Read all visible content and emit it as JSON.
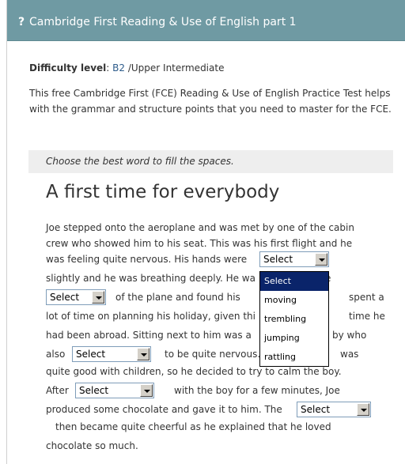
{
  "header": {
    "icon": "question-mark-icon",
    "title": "Cambridge First Reading & Use of English part 1",
    "bg_color": "#6f9aa3"
  },
  "difficulty": {
    "label": "Difficulty level",
    "level": "B2",
    "suffix": " /Upper Intermediate"
  },
  "intro": "This free Cambridge First (FCE) Reading & Use of English Practice Test helps with the grammar and structure points that you need to master for the FCE.",
  "instruction": "Choose the best word to fill the spaces.",
  "story": {
    "title": "A first time for everybody",
    "lines": [
      "Joe stepped onto the aeroplane and was met by one of the cabin",
      "crew who showed him to his seat. This was his first flight and he",
      "was feeling quite nervous. His hands were",
      "slightly and he was breathing deeply. He wa",
      "e",
      "of the plane and found his",
      "spent a",
      "lot of time on planning his holiday, given thi",
      "time he",
      "had been abroad. Sitting next to him was a",
      "by who",
      "also",
      "to be quite nervous.",
      "was",
      "quite good with children, so he decided to try to calm the boy.",
      "After",
      "with the boy for a few minutes, Joe",
      "produced some chocolate and gave it to him. The",
      "then became quite cheerful as he explained that he loved",
      "chocolate so much."
    ]
  },
  "selects": {
    "gap1": "Select",
    "gap2": "Select",
    "gap3": "Select",
    "gap4": "Select",
    "gap5": "Select"
  },
  "dropdown": {
    "options": [
      "Select",
      "moving",
      "trembling",
      "jumping",
      "rattling"
    ],
    "active_index": 0,
    "highlight_color": "#0a246a"
  }
}
